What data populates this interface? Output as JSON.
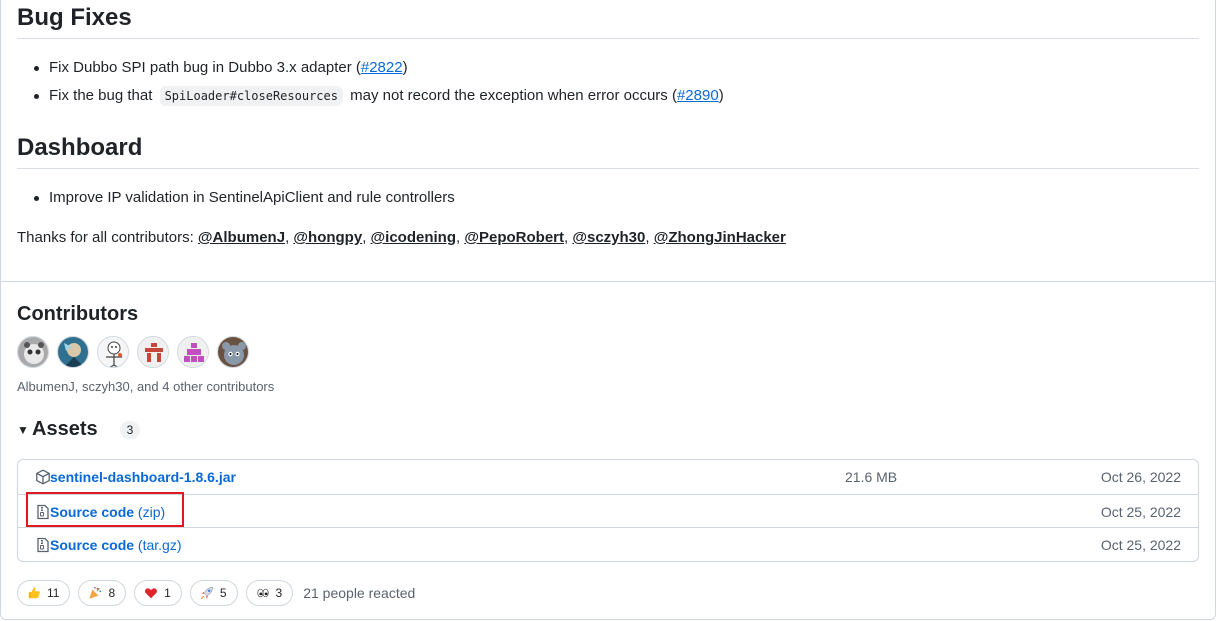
{
  "bug_fixes": {
    "title": "Bug Fixes",
    "items": [
      {
        "text": "Fix Dubbo SPI path bug in Dubbo 3.x adapter (",
        "link": "#2822",
        "after": ")"
      },
      {
        "before": "Fix the bug that",
        "code": "SpiLoader#closeResources",
        "text": "may not record the exception when error occurs (",
        "link": "#2890",
        "after": ")"
      }
    ]
  },
  "dashboard": {
    "title": "Dashboard",
    "items": [
      {
        "text": "Improve IP validation in SentinelApiClient and rule controllers"
      }
    ]
  },
  "thanks": {
    "prefix": "Thanks for all contributors: ",
    "users": [
      "@AlbumenJ",
      "@hongpy",
      "@icodening",
      "@PepoRobert",
      "@sczyh30",
      "@ZhongJinHacker"
    ]
  },
  "contributors": {
    "title": "Contributors",
    "summary": "AlbumenJ, sczyh30, and 4 other contributors",
    "avatar_colors": [
      "#8c8c8c",
      "#3a7ca5",
      "#f3f3f3",
      "#c8453c",
      "#c24fbf",
      "#5b6a7a"
    ]
  },
  "assets": {
    "title": "Assets",
    "count": "3",
    "rows": [
      {
        "name": "sentinel-dashboard-1.8.6.jar",
        "suffix": "",
        "size": "21.6 MB",
        "date": "Oct 26, 2022",
        "icon": "package-icon"
      },
      {
        "name": "Source code",
        "suffix": " (zip)",
        "size": "",
        "date": "Oct 25, 2022",
        "icon": "file-zip-icon"
      },
      {
        "name": "Source code",
        "suffix": " (tar.gz)",
        "size": "",
        "date": "Oct 25, 2022",
        "icon": "file-zip-icon"
      }
    ]
  },
  "reactions": {
    "items": [
      {
        "emoji": "thumbs-up",
        "count": "11"
      },
      {
        "emoji": "party-popper",
        "count": "8"
      },
      {
        "emoji": "heart",
        "count": "1"
      },
      {
        "emoji": "rocket",
        "count": "5"
      },
      {
        "emoji": "eyes",
        "count": "3"
      }
    ],
    "summary": "21 people reacted"
  },
  "colors": {
    "link": "#0969da",
    "highlight": "#e0191e",
    "border": "#d0d7de"
  }
}
